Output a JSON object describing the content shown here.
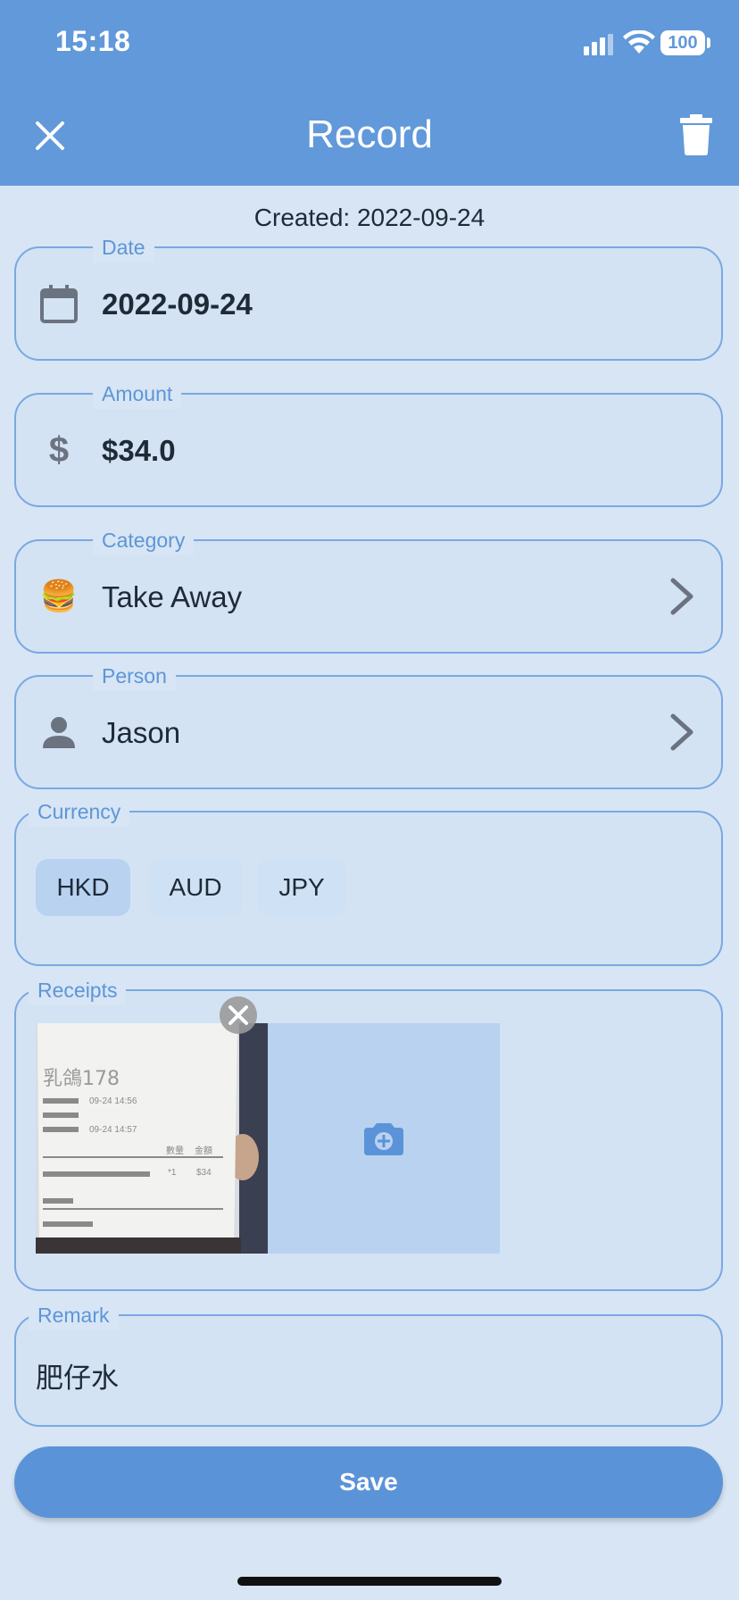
{
  "status_bar": {
    "time": "15:18",
    "battery": "100"
  },
  "app_bar": {
    "title": "Record",
    "close_icon": "close-icon",
    "delete_icon": "trash-icon"
  },
  "created_label": "Created: 2022-09-24",
  "date": {
    "label": "Date",
    "value": "2022-09-24",
    "icon": "calendar-icon"
  },
  "amount": {
    "label": "Amount",
    "value": "$34.0",
    "icon": "dollar-icon"
  },
  "category": {
    "label": "Category",
    "value": "Take Away",
    "emoji": "🍔"
  },
  "person": {
    "label": "Person",
    "value": "Jason",
    "icon": "person-icon"
  },
  "currency": {
    "label": "Currency",
    "options": [
      "HKD",
      "AUD",
      "JPY"
    ],
    "selected": "HKD"
  },
  "receipts": {
    "label": "Receipts",
    "image_text": {
      "shop": "乳鴿178",
      "time1": "09-24 14:56",
      "time2": "09-24 14:57",
      "col_qty": "數量",
      "col_amt": "金額",
      "qty": "*1",
      "amt": "$34"
    },
    "add_icon": "add-photo-icon"
  },
  "remark": {
    "label": "Remark",
    "value": "肥仔水"
  },
  "save_label": "Save",
  "colors": {
    "primary": "#6199da",
    "background": "#d7e5f5",
    "field": "#d3e3f4",
    "outline": "#7aa8e0"
  }
}
